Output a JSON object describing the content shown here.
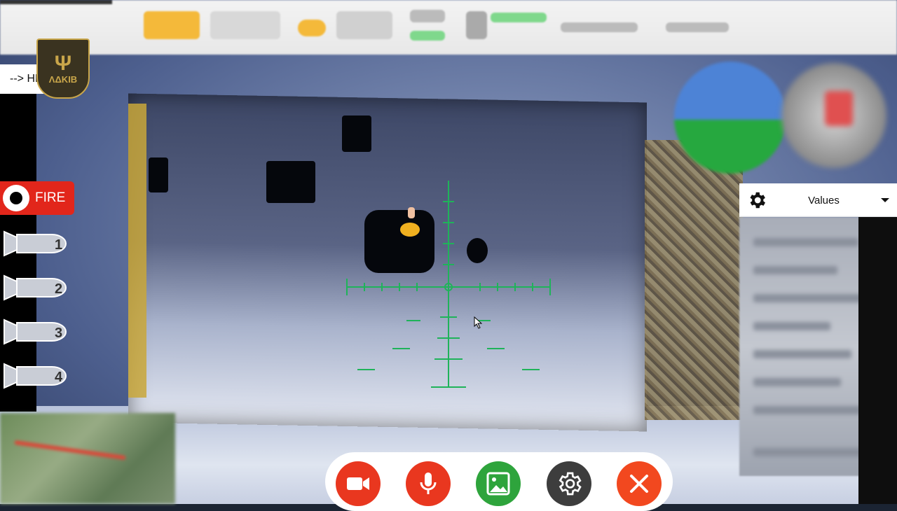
{
  "header": {
    "hl_tab_label": "--> HL",
    "logo_text": "ΛΔΚΙΒ"
  },
  "weapons": {
    "fire_label": "FIRE",
    "bombs": [
      "1",
      "2",
      "3",
      "4"
    ]
  },
  "panel": {
    "values_label": "Values"
  },
  "colors": {
    "fire": "#e2261b",
    "record": "#e9371f",
    "gallery": "#2ea43c",
    "settings": "#3d3d3d",
    "close": "#f2481f",
    "crosshair": "#1fb35a",
    "logo_gold": "#c9a64a"
  },
  "controls": {
    "icons": [
      "video-camera-icon",
      "microphone-icon",
      "gallery-icon",
      "gear-icon",
      "close-icon"
    ]
  }
}
